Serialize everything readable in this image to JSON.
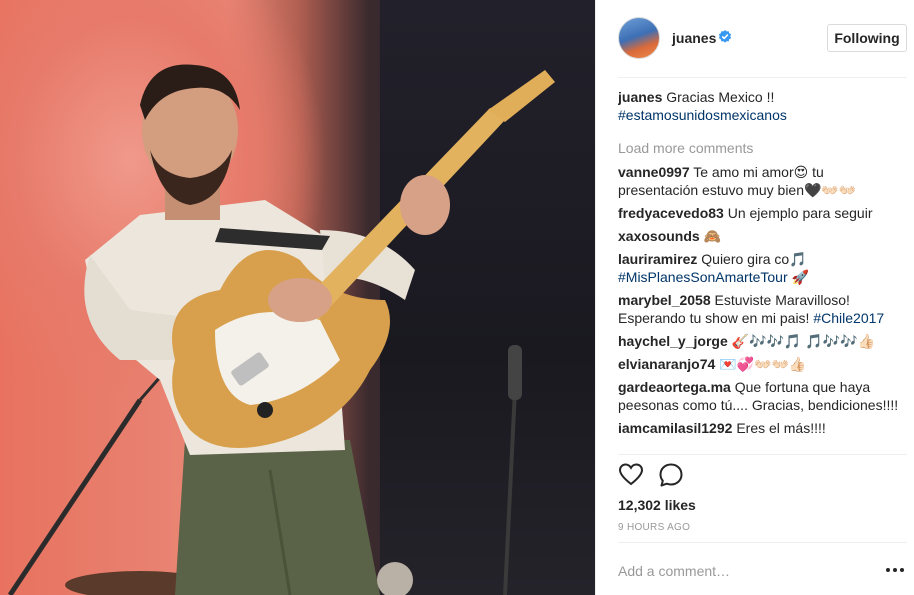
{
  "post": {
    "author": {
      "username": "juanes",
      "verified": true,
      "follow_label": "Following",
      "verified_color": "#3897f0"
    },
    "caption": {
      "username": "juanes",
      "text": "Gracias Mexico !!",
      "hashtag": "#estamosunidosmexicanos"
    },
    "load_more_label": "Load more comments",
    "comments": [
      {
        "username": "vanne0997",
        "text": "Te amo mi amor😍 tu presentación estuvo muy bien🖤👐🏻👐🏻",
        "hashtag": ""
      },
      {
        "username": "fredyacevedo83",
        "text": "Un ejemplo para seguir",
        "hashtag": ""
      },
      {
        "username": "xaxosounds",
        "text": "🙈",
        "hashtag": ""
      },
      {
        "username": "lauriramirez",
        "text": "Quiero gira co🎵",
        "hashtag": "#MisPlanesSonAmarteTour 🚀"
      },
      {
        "username": "marybel_2058",
        "text": "Estuviste Maravilloso! Esperando tu show en mi pais!",
        "hashtag": "#Chile2017"
      },
      {
        "username": "haychel_y_jorge",
        "text": "🎸🎶🎶🎵 🎵🎶🎶👍🏻",
        "hashtag": ""
      },
      {
        "username": "elvianaranjo74",
        "text": "💌💞👐🏻👐🏻👍🏻",
        "hashtag": ""
      },
      {
        "username": "gardeaortega.ma",
        "text": "Que fortuna que haya peesonas como tú.... Gracias, bendiciones!!!!",
        "hashtag": ""
      },
      {
        "username": "iamcamilasil1292",
        "text": "Eres el más!!!!",
        "hashtag": ""
      }
    ],
    "likes": "12,302 likes",
    "time_ago": "9 HOURS AGO",
    "comment_placeholder": "Add a comment…",
    "icons": {
      "like": "heart-outline-icon",
      "comment": "speech-bubble-icon",
      "more": "ellipsis-icon",
      "verified": "verified-badge-icon"
    }
  }
}
